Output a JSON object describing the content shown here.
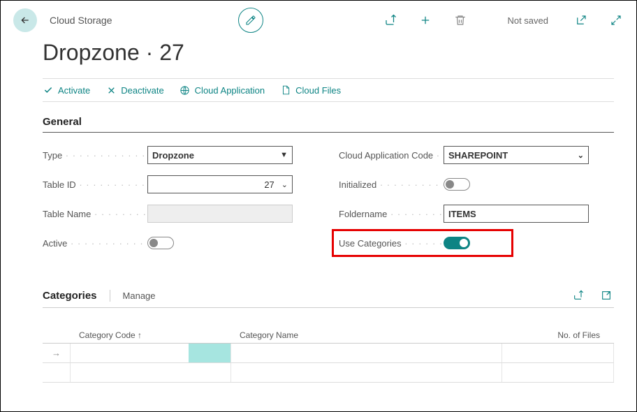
{
  "header": {
    "breadcrumb": "Cloud Storage",
    "save_status": "Not saved"
  },
  "page": {
    "title": "Dropzone · 27"
  },
  "actions": {
    "activate": "Activate",
    "deactivate": "Deactivate",
    "cloud_app": "Cloud Application",
    "cloud_files": "Cloud Files"
  },
  "sections": {
    "general": "General",
    "categories": "Categories"
  },
  "form": {
    "left": {
      "type_label": "Type",
      "type_value": "Dropzone",
      "table_id_label": "Table ID",
      "table_id_value": "27",
      "table_name_label": "Table Name",
      "table_name_value": "",
      "active_label": "Active"
    },
    "right": {
      "cloud_app_code_label": "Cloud Application Code",
      "cloud_app_code_value": "SHAREPOINT",
      "initialized_label": "Initialized",
      "foldername_label": "Foldername",
      "foldername_value": "ITEMS",
      "use_categories_label": "Use Categories"
    }
  },
  "categories": {
    "manage": "Manage",
    "columns": {
      "code": "Category Code ↑",
      "name": "Category Name",
      "files": "No. of Files"
    }
  }
}
